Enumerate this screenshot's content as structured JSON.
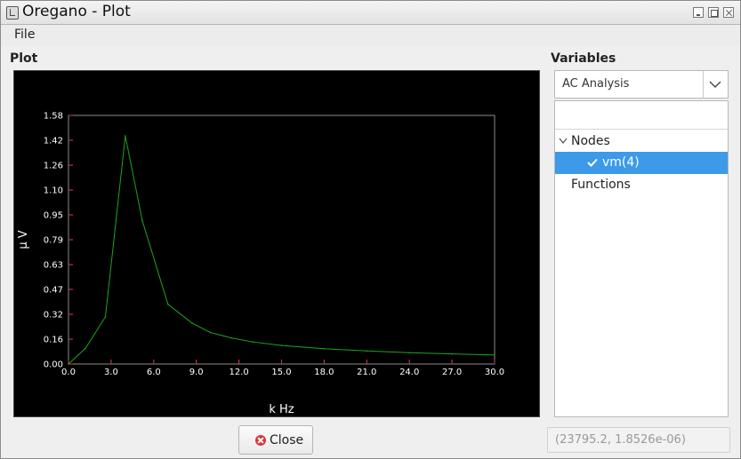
{
  "window": {
    "title": "Oregano - Plot"
  },
  "menu": {
    "file": "File"
  },
  "plot_section": {
    "label": "Plot"
  },
  "variables_section": {
    "label": "Variables",
    "analysis_selected": "AC Analysis",
    "search_value": "",
    "tree": {
      "nodes_label": "Nodes",
      "selected_node": "vm(4)",
      "selected_checked": true,
      "functions_label": "Functions"
    }
  },
  "close_button": {
    "label": "Close"
  },
  "cursor_coords": "(23795.2, 1.8526e-06)",
  "chart_data": {
    "type": "line",
    "xlabel": "k Hz",
    "ylabel": "μ V",
    "xlim": [
      0,
      30
    ],
    "ylim": [
      0,
      1.58
    ],
    "x_ticks": [
      "0.0",
      "3.0",
      "6.0",
      "9.0",
      "12.0",
      "15.0",
      "18.0",
      "21.0",
      "24.0",
      "27.0",
      "30.0"
    ],
    "y_ticks": [
      "0.00",
      "0.16",
      "0.32",
      "0.47",
      "0.63",
      "0.79",
      "0.95",
      "1.10",
      "1.26",
      "1.42",
      "1.58"
    ],
    "colors": {
      "background": "#000000",
      "line": "#1fa51f",
      "tick": "#c0304a",
      "frame": "#8c8c8c",
      "text": "#ffffff"
    },
    "series": [
      {
        "x": [
          0,
          1.2,
          2.6,
          4.0,
          5.2,
          7.0,
          8.7,
          10.0,
          11.5,
          13.0,
          15.0,
          18.0,
          21.0,
          24.0,
          27.0,
          30.0
        ],
        "y": [
          0.0,
          0.1,
          0.3,
          1.45,
          0.91,
          0.38,
          0.26,
          0.2,
          0.165,
          0.14,
          0.118,
          0.097,
          0.083,
          0.072,
          0.064,
          0.057
        ]
      }
    ]
  }
}
